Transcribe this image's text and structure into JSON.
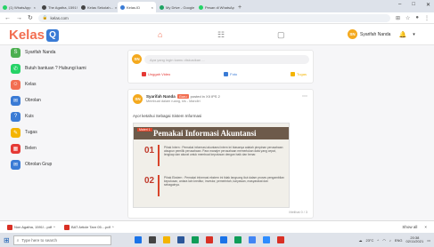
{
  "browser": {
    "tabs": [
      {
        "label": "(1) WhatsApp",
        "color": "#25d366",
        "active": false
      },
      {
        "label": "The Agatha, 1591!...",
        "color": "#444444",
        "active": false
      },
      {
        "label": "Kelas Sekolah...",
        "color": "#444444",
        "active": false
      },
      {
        "label": "Kelas.ID",
        "color": "#3a7bd5",
        "active": true
      },
      {
        "label": "My Drive - Google D...",
        "color": "#1fa463",
        "active": false
      },
      {
        "label": "Pesan di WhatsApp",
        "color": "#25d366",
        "active": false
      }
    ],
    "new_tab": "+",
    "url": "kelas.com"
  },
  "app": {
    "logo": "Kelas",
    "logo_mark": "Q",
    "user_initials": "SN",
    "user_name": "Syarifah Nanda"
  },
  "sidebar": {
    "items": [
      {
        "label": "Syarifah Nanda",
        "icon": "user-avatar-icon",
        "color": "#4caf50",
        "glyph": "S"
      },
      {
        "label": "Butuh bantuan ? Hubungi kami",
        "icon": "whatsapp-icon",
        "color": "#25d366",
        "glyph": "✆"
      },
      {
        "label": "Kelas",
        "icon": "people-icon",
        "color": "#f26e51",
        "glyph": "☺"
      },
      {
        "label": "Obrolan",
        "icon": "chat-icon",
        "color": "#3a7bd5",
        "glyph": "✉"
      },
      {
        "label": "Kuis",
        "icon": "quiz-icon",
        "color": "#3a7bd5",
        "glyph": "?"
      },
      {
        "label": "Tugas",
        "icon": "task-icon",
        "color": "#f4b400",
        "glyph": "✎"
      },
      {
        "label": "Belen",
        "icon": "calendar-icon",
        "color": "#e53935",
        "glyph": "▦"
      },
      {
        "label": "Obrolan Grup",
        "icon": "group-chat-icon",
        "color": "#3a7bd5",
        "glyph": "✉"
      }
    ]
  },
  "composer": {
    "initials": "SN",
    "placeholder": "Apa yang ingin kamu diskusikan ...",
    "actions": [
      {
        "label": "Unggah Video",
        "color": "#e53935"
      },
      {
        "label": "Foto",
        "color": "#3a7bd5"
      },
      {
        "label": "Tugas",
        "color": "#f4b400"
      }
    ]
  },
  "post": {
    "author": "Syarifah Nanda",
    "badge": "Guru",
    "context": "posted in XII IPS 2",
    "meta": "Membuat dalam ruang, kls - Mandiri",
    "text": "Ayo! ketahui Sebagai Sistem Informasi",
    "slide": {
      "tag": "Materi 1",
      "title": "Pemakai Informasi Akuntansi",
      "points": [
        {
          "num": "01",
          "desc": "Pihak Intern : Pemakai informasi akuntansi intern ini biasanya adalah pimpinan perusahaan ataupun pemilik perusahaan. Para manajer perusahaan memerlukan data yang cepat, lengkap dan akurat untuk membuat keputusan dengan baik dan benar."
        },
        {
          "num": "02",
          "desc": "Pihak Ekstern : Pemakai informasi ekstern ini tidak langsung ikut dalam proses pengambilan keputusan, antara lain kreditur, investor, pemerintah, karyawan, masyarakat dan sebagainya."
        }
      ]
    },
    "footer": "Melihat 0 / 3"
  },
  "downloads": {
    "files": [
      "Non Agatha, 1591!...pdf",
      "BAT Article Tanr 05....pdf"
    ],
    "show_all": "Show all",
    "close": "×"
  },
  "taskbar": {
    "search_placeholder": "Type here to search",
    "weather": "23°C",
    "lang": "ENG",
    "time": "20:38",
    "date": "02/11/2021",
    "app_colors": [
      "#1a73e8",
      "#444444",
      "#f4b400",
      "#2b579a",
      "#0f9d58",
      "#d93025",
      "#1a73e8",
      "#0f9d58",
      "#4285f4",
      "#2d8cff",
      "#d93025"
    ]
  }
}
